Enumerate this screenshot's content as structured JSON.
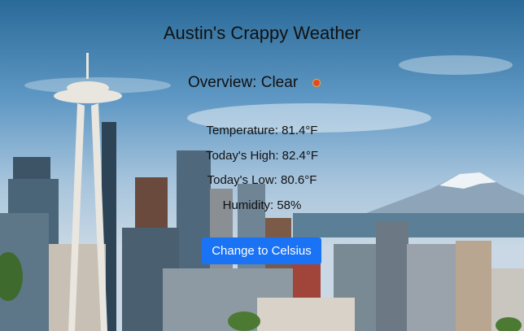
{
  "app": {
    "title": "Austin's Crappy Weather"
  },
  "overview": {
    "label": "Overview: Clear",
    "icon": "sun-icon"
  },
  "stats": {
    "temperature": "Temperature: 81.4°F",
    "high": "Today's High: 82.4°F",
    "low": "Today's Low: 80.6°F",
    "humidity": "Humidity: 58%"
  },
  "actions": {
    "toggle_unit_label": "Change to Celsius"
  },
  "colors": {
    "button": "#1a72f4",
    "text": "#111111",
    "sun": "#e4462a"
  }
}
